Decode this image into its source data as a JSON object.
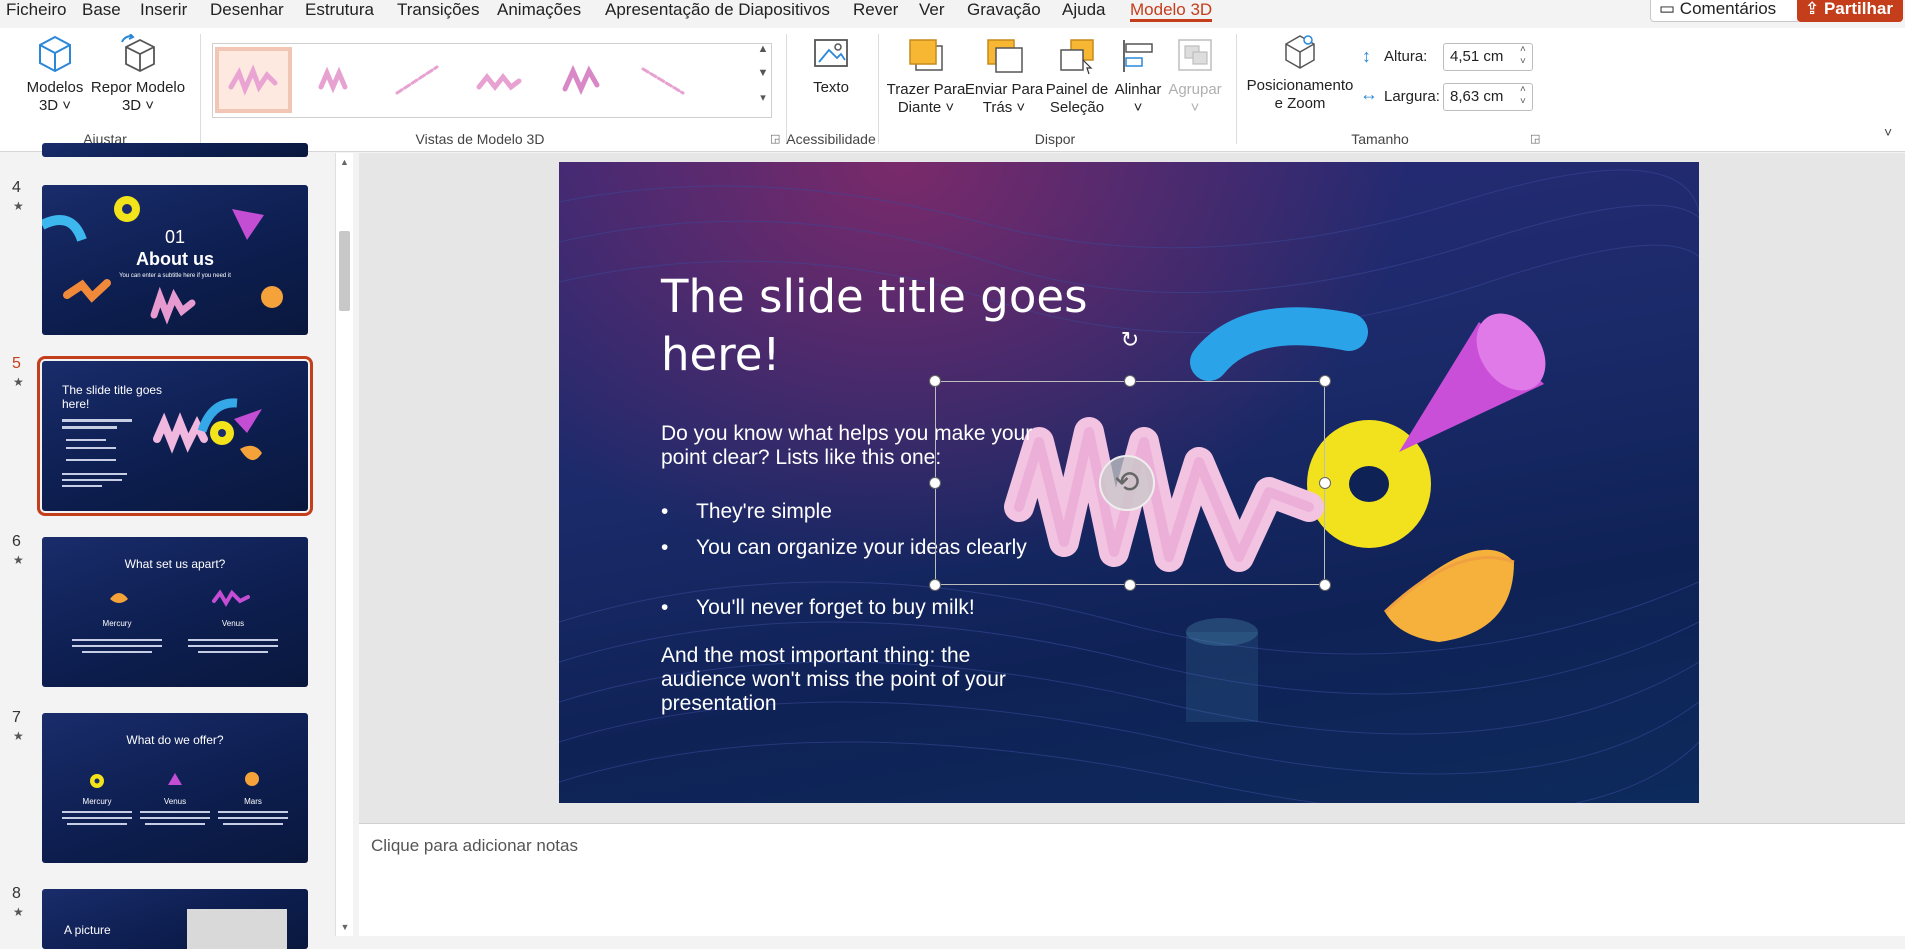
{
  "menu": {
    "items": [
      "Ficheiro",
      "Base",
      "Inserir",
      "Desenhar",
      "Estrutura",
      "Transições",
      "Animações",
      "Apresentação de Diapositivos",
      "Rever",
      "Ver",
      "Gravação",
      "Ajuda",
      "Modelo 3D"
    ],
    "active_index": 12,
    "comments_label": "Comentários",
    "share_label": "Partilhar"
  },
  "ribbon": {
    "modelos3d_line1": "Modelos",
    "modelos3d_line2": "3D",
    "repor_line1": "Repor Modelo",
    "repor_line2": "3D",
    "group_ajustar": "Ajustar",
    "group_vistas": "Vistas de Modelo 3D",
    "texto": "Texto",
    "group_acessibilidade": "Acessibilidade",
    "trazer_line1": "Trazer Para",
    "trazer_line2": "Diante",
    "enviar_line1": "Enviar Para",
    "enviar_line2": "Trás",
    "painel_line1": "Painel de",
    "painel_line2": "Seleção",
    "alinhar": "Alinhar",
    "agrupar": "Agrupar",
    "group_dispor": "Dispor",
    "posicionamento_line1": "Posicionamento",
    "posicionamento_line2": "e Zoom",
    "altura_label": "Altura:",
    "altura_value": "4,51 cm",
    "largura_label": "Largura:",
    "largura_value": "8,63 cm",
    "group_tamanho": "Tamanho"
  },
  "thumbnails": [
    {
      "num": "4",
      "star": "★",
      "title_line1": "01",
      "title_line2": "About us",
      "subtitle": "You can enter a subtitle here if you need it"
    },
    {
      "num": "5",
      "star": "★",
      "title": "The slide title goes here!",
      "selected": true
    },
    {
      "num": "6",
      "star": "★",
      "title": "What set us apart?",
      "col1_title": "Mercury",
      "col2_title": "Venus"
    },
    {
      "num": "7",
      "star": "★",
      "title": "What do we offer?",
      "col1_title": "Mercury",
      "col2_title": "Venus",
      "col3_title": "Mars"
    },
    {
      "num": "8",
      "star": "★",
      "title": "A picture"
    }
  ],
  "slide": {
    "title": "The slide title goes here!",
    "intro": "Do you know what helps you make your point clear? Lists like this one:",
    "bullets": [
      "They're simple",
      "You can organize your ideas clearly",
      "You'll never forget to buy milk!"
    ],
    "closing": "And the most important thing: the audience won't miss the point of your presentation"
  },
  "notes": {
    "placeholder": "Clique para adicionar notas"
  }
}
